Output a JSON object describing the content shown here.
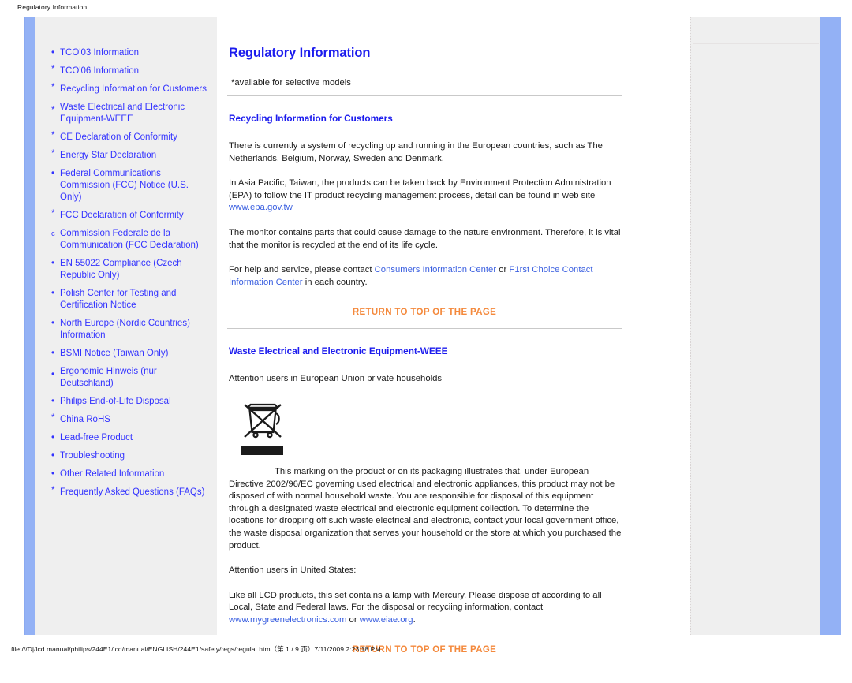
{
  "print": {
    "header_title": "Regulatory Information",
    "footer": "file:///D|/lcd manual/philips/244E1/lcd/manual/ENGLISH/244E1/safety/regs/regulat.htm（第 1 / 9 页）7/11/2009 2:23:18 PM"
  },
  "colors": {
    "link_blue": "#3333ff",
    "heading_blue": "#1b1bee",
    "inline_link": "#3a5fe0",
    "return_orange": "#f4893c",
    "panel_grey": "#efefef",
    "rail_blue": "#93b1f5"
  },
  "sidebar": {
    "items": [
      {
        "bullet": "•",
        "bullet_style": "normal",
        "label": "TCO'03 Information"
      },
      {
        "bullet": "*",
        "bullet_style": "raised",
        "label": "TCO'06 Information"
      },
      {
        "bullet": "*",
        "bullet_style": "raised",
        "label": "Recycling Information for Customers"
      },
      {
        "bullet": "*",
        "bullet_style": "lowered",
        "label": "Waste Electrical and Electronic Equipment-WEEE"
      },
      {
        "bullet": "*",
        "bullet_style": "raised",
        "label": "CE Declaration of Conformity"
      },
      {
        "bullet": "*",
        "bullet_style": "raised",
        "label": "Energy Star Declaration"
      },
      {
        "bullet": "•",
        "bullet_style": "normal",
        "label": "Federal Communications Commission (FCC) Notice (U.S. Only)"
      },
      {
        "bullet": "*",
        "bullet_style": "raised",
        "label": "FCC Declaration of Conformity"
      },
      {
        "bullet": "c",
        "bullet_style": "letter",
        "label": "Commission Federale de la Communication (FCC Declaration)"
      },
      {
        "bullet": "•",
        "bullet_style": "normal",
        "label": "EN 55022 Compliance (Czech Republic Only)"
      },
      {
        "bullet": "•",
        "bullet_style": "normal",
        "label": "Polish Center for Testing and Certification Notice"
      },
      {
        "bullet": "•",
        "bullet_style": "normal",
        "label": "North Europe (Nordic Countries) Information"
      },
      {
        "bullet": "•",
        "bullet_style": "normal",
        "label": "BSMI Notice (Taiwan Only)"
      },
      {
        "bullet": "•",
        "bullet_style": "lowered",
        "label": "Ergonomie Hinweis (nur Deutschland)"
      },
      {
        "bullet": "•",
        "bullet_style": "normal",
        "label": "Philips End-of-Life Disposal"
      },
      {
        "bullet": "*",
        "bullet_style": "raised",
        "label": "China RoHS"
      },
      {
        "bullet": "•",
        "bullet_style": "normal",
        "label": "Lead-free Product"
      },
      {
        "bullet": "•",
        "bullet_style": "normal",
        "label": "Troubleshooting"
      },
      {
        "bullet": "•",
        "bullet_style": "normal",
        "label": "Other Related Information"
      },
      {
        "bullet": "*",
        "bullet_style": "raised",
        "label": "Frequently Asked Questions (FAQs)"
      }
    ]
  },
  "main": {
    "title": "Regulatory Information",
    "note": "*available for selective models",
    "section1": {
      "heading": "Recycling Information for Customers",
      "p1": "There is currently a system of recycling up and running in the European countries, such as The Netherlands, Belgium, Norway, Sweden and Denmark.",
      "p2_before": "In Asia Pacific, Taiwan, the products can be taken back by Environment Protection Administration (EPA) to follow the IT product recycling management process, detail can be found in web site ",
      "p2_link": "www.epa.gov.tw",
      "p3": "The monitor contains parts that could cause damage to the nature environment. Therefore, it is vital that the monitor is recycled at the end of its life cycle.",
      "p4_before": "For help and service, please contact ",
      "p4_link1": "Consumers Information Center",
      "p4_mid": " or ",
      "p4_link2": "F1rst Choice Contact Information Center",
      "p4_after": " in each country.",
      "return_top": "RETURN TO TOP OF THE PAGE"
    },
    "section2": {
      "heading": "Waste Electrical and Electronic Equipment-WEEE",
      "p1": "Attention users in European Union private households",
      "symbol_name": "crossed-out-wheelie-bin",
      "p2": "This marking on the product or on its packaging illustrates that, under European Directive 2002/96/EC governing used electrical and electronic appliances, this product may not be disposed of with normal household waste. You are responsible for disposal of this equipment through a designated waste electrical and electronic equipment collection. To determine the locations for dropping off such waste electrical and electronic, contact your local government office, the waste disposal organization that serves your household or the store at which you purchased the product.",
      "p3": "Attention users in United States:",
      "p4_before": "Like all LCD products, this set contains a lamp with Mercury. Please dispose of according to all Local, State and Federal laws. For the disposal or recyciing information, contact ",
      "p4_link1": "www.mygreenelectronics.com",
      "p4_mid": " or ",
      "p4_link2": "www.eiae.org",
      "p4_after": ".",
      "return_top": "RETURN TO TOP OF THE PAGE"
    }
  }
}
